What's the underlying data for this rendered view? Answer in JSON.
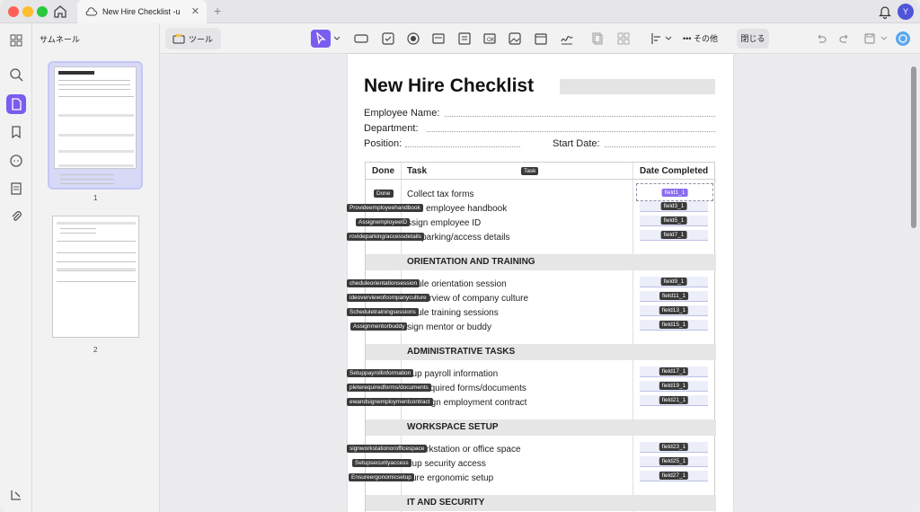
{
  "titlebar": {
    "tab_title": "New Hire Checklist -u",
    "tab_close": "✕",
    "new_tab": "+",
    "user_initial": "Y"
  },
  "thumbnails": {
    "title": "サムネール",
    "pages": [
      "1",
      "2"
    ]
  },
  "toolbar": {
    "tools_label": "ツール",
    "more_label": "その他",
    "close_label": "閉じる"
  },
  "document": {
    "title": "New Hire Checklist",
    "fields": {
      "employee_name": "Employee Name:",
      "department": "Department:",
      "position": "Position:",
      "start_date": "Start Date:"
    },
    "table": {
      "headers": {
        "done": "Done",
        "task": "Task",
        "date": "Date Completed"
      },
      "task_tag": "Task",
      "done_tag": "Done",
      "rows": [
        {
          "task": "Collect tax forms",
          "tag": "",
          "field": "field1_1"
        },
        {
          "task": "vide employee handbook",
          "tag": "Provideemployeehandbook",
          "field": "field3_1"
        },
        {
          "task": "ssign employee ID",
          "tag": "AssignemployeeID",
          "field": "field5_1"
        },
        {
          "task": "ide parking/access details",
          "tag": "rovideparking/accessdetails",
          "field": "field7_1"
        }
      ],
      "sections": [
        {
          "title": "ORIENTATION AND TRAINING",
          "rows": [
            {
              "task": "edule orientation session",
              "tag": "cheduleorientationsession",
              "field": "field9_1"
            },
            {
              "task": "e overview of company culture",
              "tag": "ideoverviewofcompanyculture",
              "field": "field11_1"
            },
            {
              "task": "edule training sessions",
              "tag": "Scheduletrainingsessions",
              "field": "field13_1"
            },
            {
              "task": "sign mentor or buddy",
              "tag": "Assignmentorbuddy",
              "field": "field15_1"
            }
          ]
        },
        {
          "title": "ADMINISTRATIVE TASKS",
          "rows": [
            {
              "task": "t up payroll information",
              "tag": "Setuppayrollinformation",
              "field": "field17_1"
            },
            {
              "task": "ete required forms/documents",
              "tag": "pleterequiredforms/documents",
              "field": "field19_1"
            },
            {
              "task": "and sign employment contract",
              "tag": "ewandsignemploymentcontract",
              "field": "field21_1"
            }
          ]
        },
        {
          "title": "WORKSPACE SETUP",
          "rows": [
            {
              "task": "n workstation or office space",
              "tag": "signworkstationorofficespace",
              "field": "field23_1"
            },
            {
              "task": "t up security access",
              "tag": "Setupsecurityaccess",
              "field": "field25_1"
            },
            {
              "task": "sure ergonomic setup",
              "tag": "Ensureergonomicsetup",
              "field": "field27_1"
            }
          ]
        },
        {
          "title": "IT AND SECURITY",
          "rows": []
        }
      ]
    }
  }
}
